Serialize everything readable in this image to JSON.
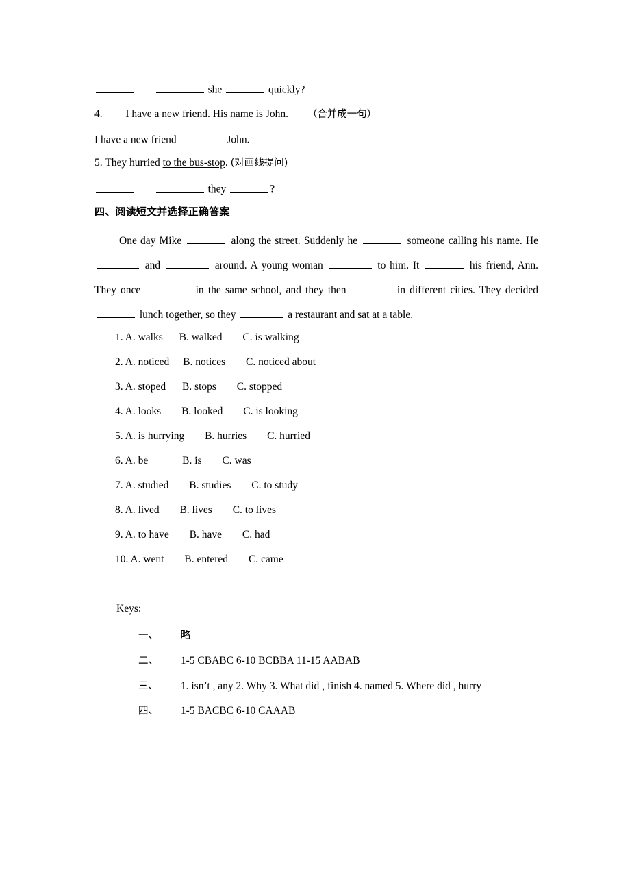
{
  "document": {
    "type": "worksheet",
    "language": "en-zh"
  },
  "exercises": {
    "q3_answer_line": {
      "tail_1": "she",
      "tail_2": "quickly?"
    },
    "q4": {
      "number": "4.",
      "prompt": "I have a new friend. His name is John.",
      "instruction": "（合并成一句）",
      "answer_prefix": "I have a new friend",
      "answer_suffix": "John."
    },
    "q5": {
      "number": "5.",
      "text_before": "They hurried",
      "underlined": "to the bus-stop",
      "text_after": ".",
      "instruction": "(对画线提问)",
      "answer_mid": "they",
      "answer_end": "?"
    }
  },
  "section_four": {
    "heading": "四、阅读短文并选择正确答案",
    "passage_parts": [
      "One day Mike",
      "along the street. Suddenly he",
      "someone calling his name. He",
      "and",
      "around. A young woman",
      "to him. It",
      "his friend, Ann. They once",
      "in the same school, and they then",
      "in different cities. They decided",
      "lunch together, so they",
      "a restaurant and sat at a table."
    ],
    "questions": [
      {
        "num": "1.",
        "a": "A. walks",
        "b": "B. walked",
        "c": "C. is walking"
      },
      {
        "num": "2.",
        "a": "A. noticed",
        "b": "B. notices",
        "c": "C. noticed about"
      },
      {
        "num": "3.",
        "a": "A. stoped",
        "b": "B. stops",
        "c": "C. stopped"
      },
      {
        "num": "4.",
        "a": "A. looks",
        "b": "B. looked",
        "c": "C. is looking"
      },
      {
        "num": "5.",
        "a": "A. is hurrying",
        "b": "B. hurries",
        "c": "C. hurried"
      },
      {
        "num": "6.",
        "a": "A. be",
        "b": "B. is",
        "c": "C. was"
      },
      {
        "num": "7.",
        "a": "A. studied",
        "b": "B. studies",
        "c": "C. to study"
      },
      {
        "num": "8.",
        "a": "A. lived",
        "b": "B. lives",
        "c": "C. to lives"
      },
      {
        "num": "9.",
        "a": "A. to have",
        "b": "B. have",
        "c": "C. had"
      },
      {
        "num": "10.",
        "a": "A. went",
        "b": "B. entered",
        "c": "C. came"
      }
    ]
  },
  "keys": {
    "label": "Keys:",
    "rows": [
      {
        "num": "一、",
        "value": "略"
      },
      {
        "num": "二、",
        "value": "1-5 CBABC   6-10 BCBBA    11-15 AABAB"
      },
      {
        "num": "三、",
        "value": "1. isn’t , any   2. Why   3. What did , finish   4. named   5. Where did , hurry"
      },
      {
        "num": "四、",
        "value": "1-5 BACBC   6-10   CAAAB"
      }
    ]
  },
  "colors": {
    "text": "#000000",
    "background": "#ffffff"
  }
}
